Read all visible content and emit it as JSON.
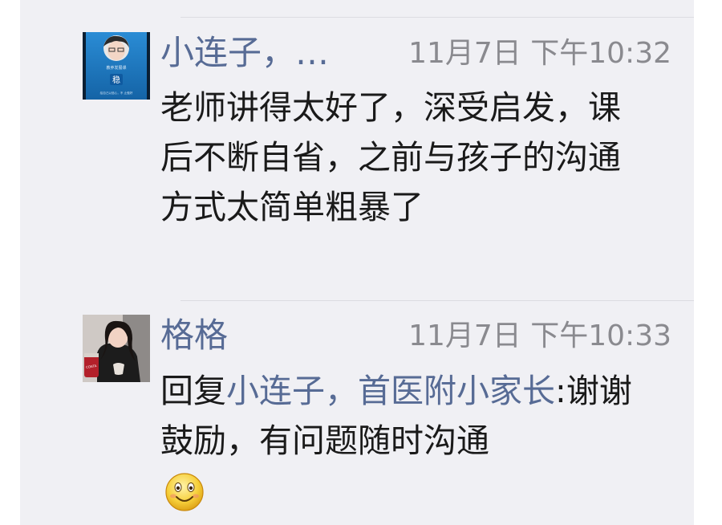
{
  "comments": [
    {
      "author": "小连子，…",
      "time": "11月7日 下午10:32",
      "text": "老师讲得太好了，深受启发，课后不断自省，之前与孩子的沟通方式太简单粗暴了",
      "avatar": {
        "top_text": "教养发展课",
        "badge_text": "稳",
        "bottom_text": "给自己以信心，不 止做好"
      }
    },
    {
      "author": "格格",
      "time": "11月7日 下午10:33",
      "reply_prefix": "回复",
      "reply_to": "小连子，首医附小家长",
      "reply_colon": ":",
      "text": "谢谢鼓励，有问题随时沟通",
      "emoji": "smile-emoji",
      "avatar": {
        "cup_text": "COSTA"
      }
    }
  ],
  "colors": {
    "name_link": "#576b95",
    "time": "#8a8a8f",
    "background": "#f0f0f4"
  }
}
